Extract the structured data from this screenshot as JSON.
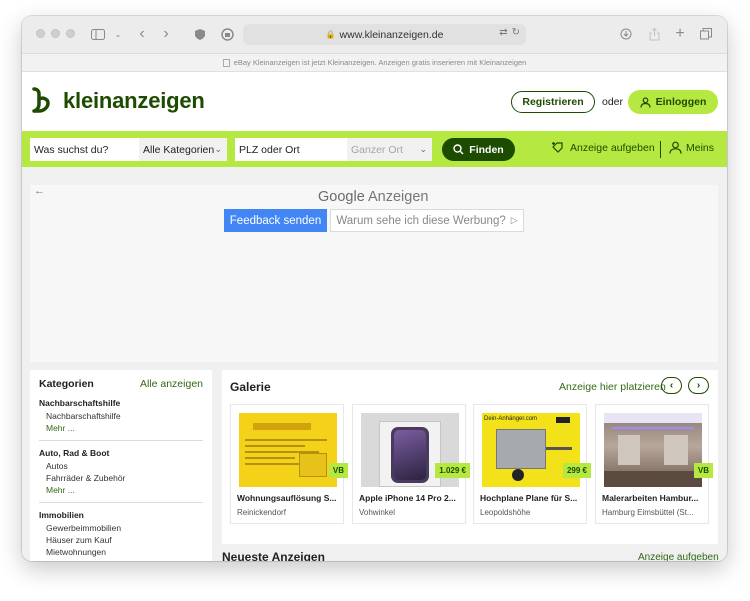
{
  "browser": {
    "url": "www.kleinanzeigen.de",
    "info_banner": "eBay Kleinanzeigen ist jetzt Kleinanzeigen. Anzeigen gratis inserieren mit Kleinanzeigen"
  },
  "header": {
    "logo_text": "kleinanzeigen",
    "register_label": "Registrieren",
    "or_text": "oder",
    "login_label": "Einloggen"
  },
  "search": {
    "query_placeholder": "Was suchst du?",
    "category_value": "Alle Kategorien",
    "location_placeholder": "PLZ oder Ort",
    "radius_value": "Ganzer Ort",
    "find_label": "Finden",
    "post_ad_label": "Anzeige aufgeben",
    "account_label": "Meins"
  },
  "ad": {
    "title_google": "Google",
    "title_rest": "Anzeigen",
    "feedback_label": "Feedback senden",
    "why_label": "Warum sehe ich diese Werbung?"
  },
  "sidebar": {
    "title": "Kategorien",
    "show_all": "Alle anzeigen",
    "groups": [
      {
        "name": "Nachbarschaftshilfe",
        "items": [
          "Nachbarschaftshilfe"
        ],
        "more": "Mehr ..."
      },
      {
        "name": "Auto, Rad & Boot",
        "items": [
          "Autos",
          "Fahrräder & Zubehör"
        ],
        "more": "Mehr ..."
      },
      {
        "name": "Immobilien",
        "items": [
          "Gewerbeimmobilien",
          "Häuser zum Kauf",
          "Mietwohnungen"
        ]
      }
    ]
  },
  "gallery": {
    "title": "Galerie",
    "place_here": "Anzeige hier platzieren",
    "cards": [
      {
        "title": "Wohnungsauflösung S...",
        "location": "Reinickendorf",
        "price": "VB"
      },
      {
        "title": "Apple iPhone 14 Pro 2...",
        "location": "Vohwinkel",
        "price": "1.029 €"
      },
      {
        "title": "Hochplane Plane für S...",
        "location": "Leopoldshöhe",
        "price": "299 €"
      },
      {
        "title": "Malerarbeiten Hambur...",
        "location": "Hamburg Eimsbüttel (St...",
        "price": "VB"
      }
    ]
  },
  "newest": {
    "title": "Neueste Anzeigen",
    "post_ad_link": "Anzeige aufgeben"
  },
  "colors": {
    "brand_green": "#b5e941",
    "brand_dark": "#1d4b00",
    "google_blue": "#4285f4"
  }
}
